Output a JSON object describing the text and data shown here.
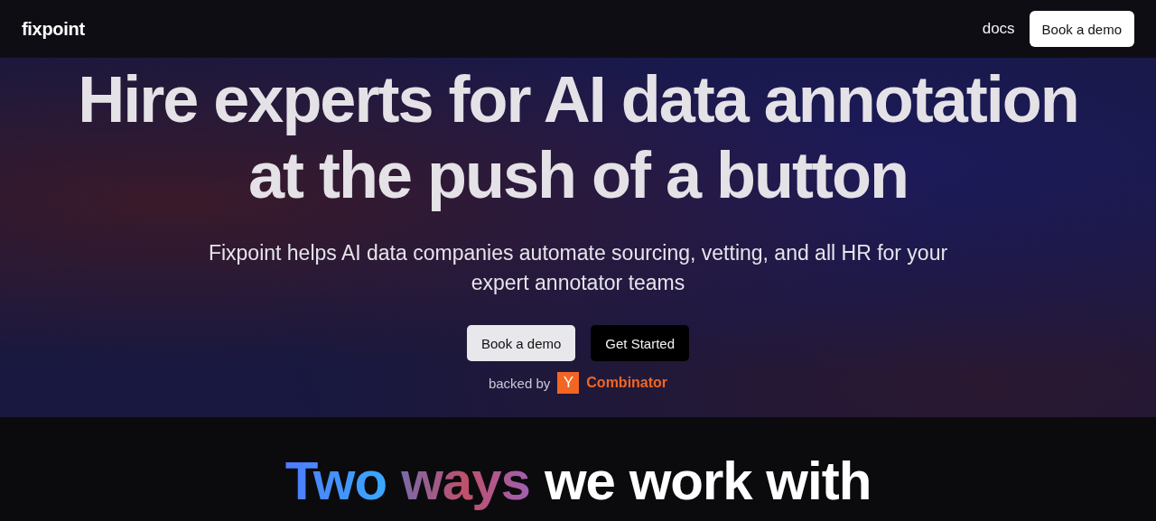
{
  "nav": {
    "logo": "fixpoint",
    "links": [
      "docs"
    ],
    "button": "Book a demo"
  },
  "hero": {
    "title_lines": [
      "Hire experts for AI data annotation",
      "at the push of a button"
    ],
    "subtitle": "Fixpoint helps AI data companies automate sourcing, vetting, and all HR for your expert annotator teams",
    "buttons": [
      {
        "label": "Book a demo",
        "kind": "light"
      },
      {
        "label": "Get Started",
        "kind": "dark"
      }
    ],
    "backed_by": {
      "label": "backed by",
      "badge": "Y",
      "name": "Combinator"
    }
  },
  "section_heading": [
    {
      "text": "Two",
      "kind": "blue"
    },
    {
      "text": "ways",
      "kind": "rose"
    },
    {
      "text": "we work with",
      "kind": "plain"
    }
  ]
}
